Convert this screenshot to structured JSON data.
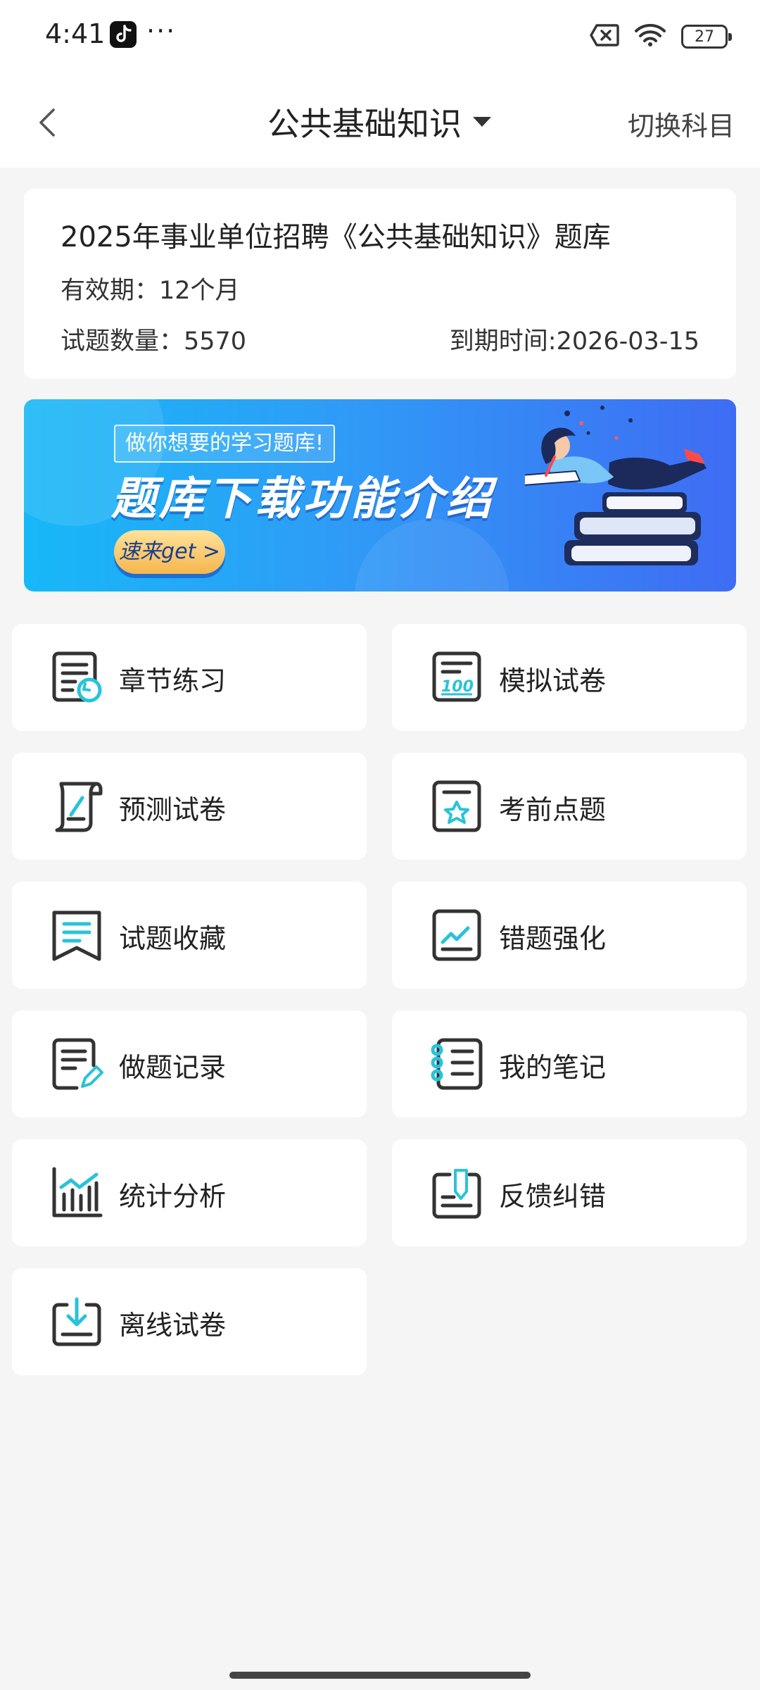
{
  "status_bar": {
    "time": "4:41",
    "battery": "27"
  },
  "header": {
    "title": "公共基础知识",
    "switch_label": "切换科目"
  },
  "info_card": {
    "title": "2025年事业单位招聘《公共基础知识》题库",
    "validity": "有效期：12个月",
    "question_count": "试题数量：5570",
    "expire": "到期时间:2026-03-15"
  },
  "banner": {
    "subtitle": "做你想要的学习题库!",
    "headline": "题库下载功能介绍",
    "button": "速来get >"
  },
  "menu": [
    {
      "label": "章节练习",
      "icon": "chapter-practice-icon"
    },
    {
      "label": "模拟试卷",
      "icon": "mock-exam-icon"
    },
    {
      "label": "预测试卷",
      "icon": "forecast-exam-icon"
    },
    {
      "label": "考前点题",
      "icon": "key-points-icon"
    },
    {
      "label": "试题收藏",
      "icon": "favorites-icon"
    },
    {
      "label": "错题强化",
      "icon": "wrong-questions-icon"
    },
    {
      "label": "做题记录",
      "icon": "practice-record-icon"
    },
    {
      "label": "我的笔记",
      "icon": "notes-icon"
    },
    {
      "label": "统计分析",
      "icon": "statistics-icon"
    },
    {
      "label": "反馈纠错",
      "icon": "feedback-icon"
    },
    {
      "label": "离线试卷",
      "icon": "offline-download-icon"
    }
  ],
  "colors": {
    "accent": "#29c3d8",
    "icon_stroke": "#333333",
    "background": "#f5f5f5"
  }
}
